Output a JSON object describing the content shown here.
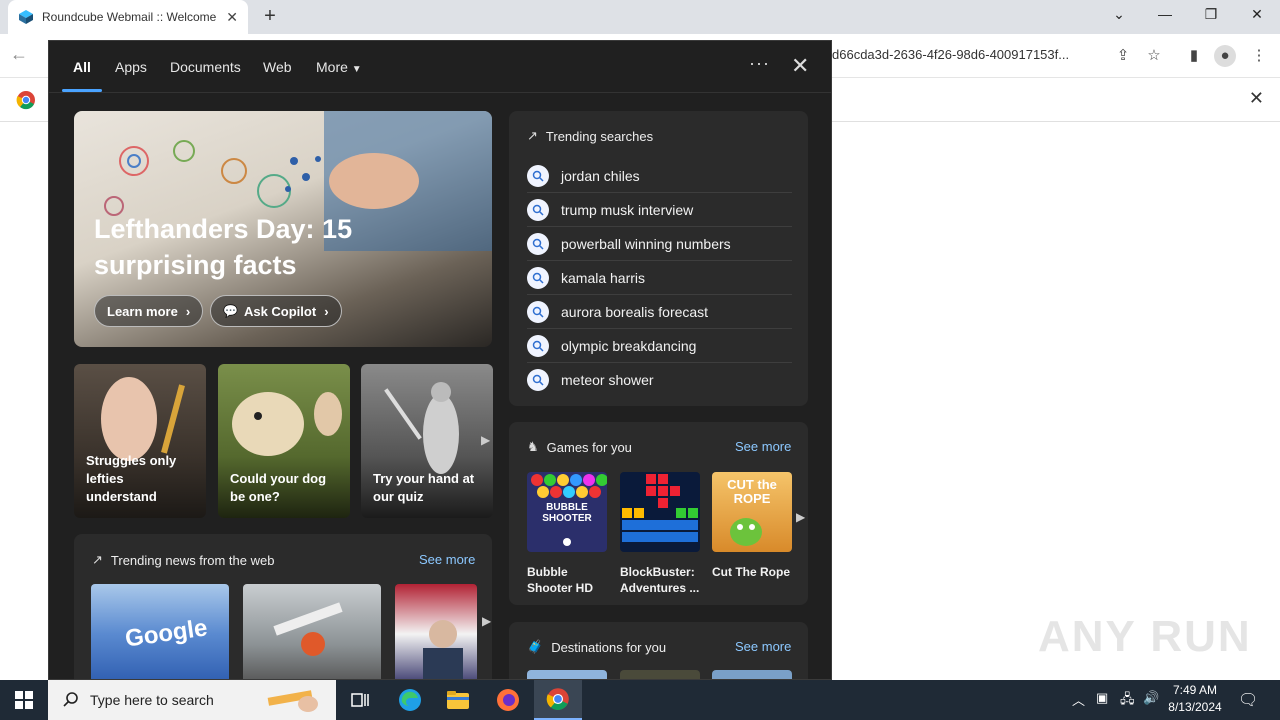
{
  "browser": {
    "tab_title": "Roundcube Webmail :: Welcome",
    "address_fragment": "d66cda3d-2636-4f26-98d6-400917153f..."
  },
  "flyout": {
    "nav": {
      "tabs": [
        "All",
        "Apps",
        "Documents",
        "Web",
        "More"
      ],
      "active": "All"
    },
    "hero": {
      "title": "Lefthanders Day: 15 surprising facts",
      "learn_more": "Learn more",
      "ask_copilot": "Ask Copilot"
    },
    "cards": [
      {
        "caption": "Struggles only lefties understand"
      },
      {
        "caption": "Could your dog be one?"
      },
      {
        "caption": "Try your hand at our quiz"
      }
    ],
    "trending": {
      "heading": "Trending searches",
      "items": [
        "jordan chiles",
        "trump musk interview",
        "powerball winning numbers",
        "kamala harris",
        "aurora borealis forecast",
        "olympic breakdancing",
        "meteor shower"
      ]
    },
    "games": {
      "heading": "Games for you",
      "see_more": "See more",
      "items": [
        {
          "name": "Bubble Shooter HD"
        },
        {
          "name": "BlockBuster: Adventures ..."
        },
        {
          "name": "Cut The Rope"
        }
      ],
      "thumb_text": {
        "bubble": "BUBBLE SHOOTER",
        "rope": "CUT the ROPE"
      }
    },
    "news": {
      "heading": "Trending news from the web",
      "see_more": "See more",
      "google_text": "Google"
    },
    "destinations": {
      "heading": "Destinations for you",
      "see_more": "See more"
    }
  },
  "watermark": "ANY RUN",
  "taskbar": {
    "search_placeholder": "Type here to search",
    "time": "7:49 AM",
    "date": "8/13/2024"
  },
  "colors": {
    "accent": "#4aa3ff",
    "link": "#8cc8ff",
    "flyout_bg": "#202020",
    "panel_bg": "#2b2b2b",
    "taskbar_bg": "#1f2a36"
  }
}
